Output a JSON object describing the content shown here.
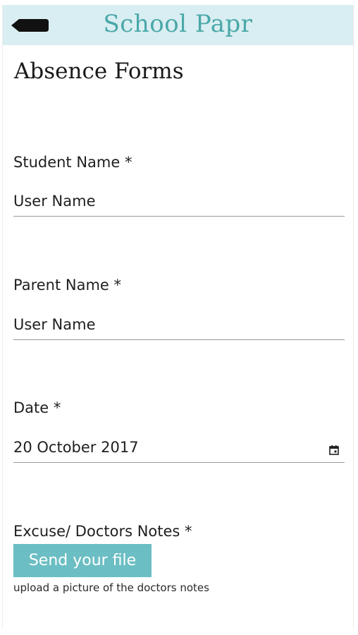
{
  "header": {
    "back_icon": "back-arrow-icon",
    "title": "School Papr",
    "background_color": "#d9eef2",
    "title_color": "#4aa8a8"
  },
  "page": {
    "title": "Absence Forms"
  },
  "form": {
    "student_name": {
      "label": "Student Name *",
      "value": "User Name"
    },
    "parent_name": {
      "label": "Parent Name *",
      "value": "User Name"
    },
    "date": {
      "label": "Date *",
      "value": "20 October 2017",
      "icon": "calendar-icon"
    },
    "excuse_notes": {
      "label": "Excuse/ Doctors Notes *",
      "button_label": "Send your file",
      "button_color": "#6bbec3",
      "helper_text": "upload a picture of the doctors notes"
    }
  }
}
